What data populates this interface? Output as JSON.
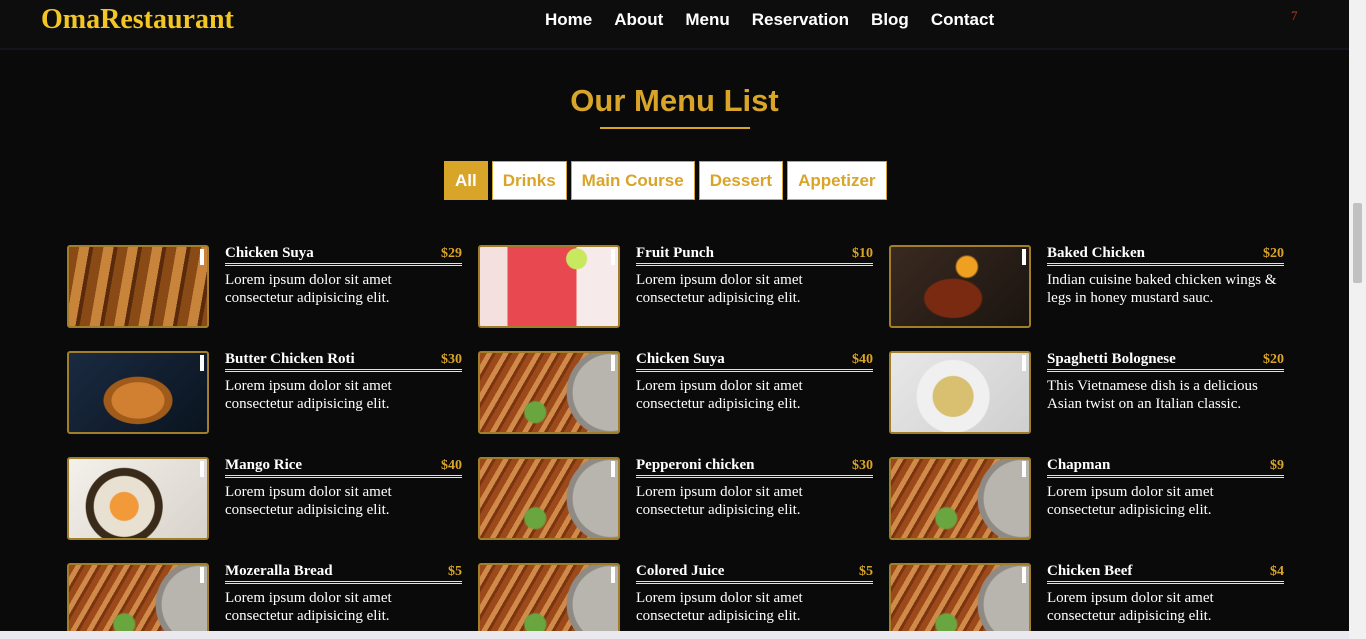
{
  "brand": "OmaRestaurant",
  "nav": [
    "Home",
    "About",
    "Menu",
    "Reservation",
    "Blog",
    "Contact"
  ],
  "cart_count": "7",
  "section": {
    "title": "Our Menu List",
    "filters": [
      "All",
      "Drinks",
      "Main Course",
      "Dessert",
      "Appetizer"
    ],
    "active_filter": "All"
  },
  "menu": [
    {
      "name": "Chicken Suya",
      "price": "$29",
      "desc": "Lorem ipsum dolor sit amet consectetur adipisicing elit.",
      "image": "chicken-suya-photo"
    },
    {
      "name": "Fruit Punch",
      "price": "$10",
      "desc": "Lorem ipsum dolor sit amet consectetur adipisicing elit.",
      "image": "fruit-punch-photo"
    },
    {
      "name": "Baked Chicken",
      "price": "$20",
      "desc": "Indian cuisine baked chicken wings & legs in honey mustard sauc.",
      "image": "baked-chicken-photo"
    },
    {
      "name": "Butter Chicken Roti",
      "price": "$30",
      "desc": "Lorem ipsum dolor sit amet consectetur adipisicing elit.",
      "image": "butter-chicken-roti-photo"
    },
    {
      "name": "Chicken Suya",
      "price": "$40",
      "desc": "Lorem ipsum dolor sit amet consectetur adipisicing elit.",
      "image": "pizza-photo"
    },
    {
      "name": "Spaghetti Bolognese",
      "price": "$20",
      "desc": "This Vietnamese dish is a delicious Asian twist on an Italian classic.",
      "image": "spaghetti-photo"
    },
    {
      "name": "Mango Rice",
      "price": "$40",
      "desc": "Lorem ipsum dolor sit amet consectetur adipisicing elit.",
      "image": "mango-rice-photo"
    },
    {
      "name": "Pepperoni chicken",
      "price": "$30",
      "desc": "Lorem ipsum dolor sit amet consectetur adipisicing elit.",
      "image": "pizza-photo"
    },
    {
      "name": "Chapman",
      "price": "$9",
      "desc": "Lorem ipsum dolor sit amet consectetur adipisicing elit.",
      "image": "pizza-photo"
    },
    {
      "name": "Mozeralla Bread",
      "price": "$5",
      "desc": "Lorem ipsum dolor sit amet consectetur adipisicing elit.",
      "image": "pizza-photo"
    },
    {
      "name": "Colored Juice",
      "price": "$5",
      "desc": "Lorem ipsum dolor sit amet consectetur adipisicing elit.",
      "image": "pizza-photo"
    },
    {
      "name": "Chicken Beef",
      "price": "$4",
      "desc": "Lorem ipsum dolor sit amet consectetur adipisicing elit.",
      "image": "pizza-photo"
    }
  ],
  "colors": {
    "brand": "#f3c623",
    "accent": "#d9a528",
    "background": "#0b0a0a"
  }
}
